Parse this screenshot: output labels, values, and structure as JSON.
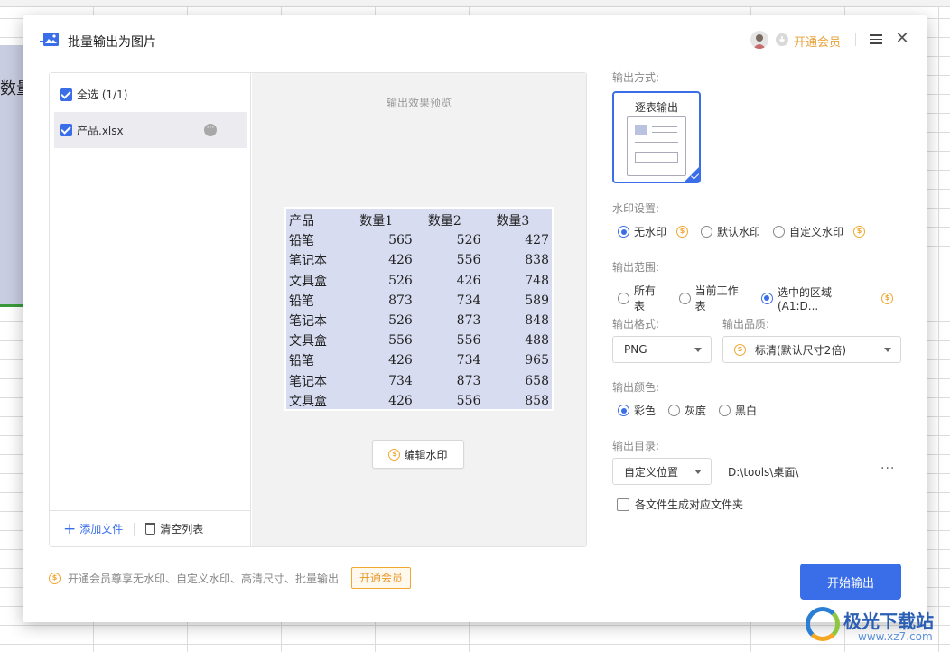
{
  "background": {
    "cell_text": "数量"
  },
  "dialog": {
    "title": "批量输出为图片",
    "vip_link": "开通会员"
  },
  "file_list": {
    "select_all": "全选 (1/1)",
    "files": [
      {
        "name": "产品.xlsx",
        "checked": true
      }
    ],
    "add_file": "添加文件",
    "clear_list": "清空列表"
  },
  "preview": {
    "label": "输出效果预览",
    "header": [
      "产品",
      "数量1",
      "数量2",
      "数量3"
    ],
    "rows": [
      [
        "铅笔",
        "565",
        "526",
        "427"
      ],
      [
        "笔记本",
        "426",
        "556",
        "838"
      ],
      [
        "文具盒",
        "526",
        "426",
        "748"
      ],
      [
        "铅笔",
        "873",
        "734",
        "589"
      ],
      [
        "笔记本",
        "526",
        "873",
        "848"
      ],
      [
        "文具盒",
        "556",
        "556",
        "488"
      ],
      [
        "铅笔",
        "426",
        "734",
        "965"
      ],
      [
        "笔记本",
        "734",
        "873",
        "658"
      ],
      [
        "文具盒",
        "426",
        "556",
        "858"
      ]
    ],
    "edit_watermark": "编辑水印",
    "table_color": "#d7dcf1"
  },
  "settings": {
    "output_mode_label": "输出方式:",
    "output_mode_card": "逐表输出",
    "watermark_label": "水印设置:",
    "watermark_options": [
      "无水印",
      "默认水印",
      "自定义水印"
    ],
    "watermark_selected": 0,
    "range_label": "输出范围:",
    "range_options": [
      "所有表",
      "当前工作表",
      "选中的区域(A1:D..."
    ],
    "range_selected": 2,
    "format_label": "输出格式:",
    "format_value": "PNG",
    "quality_label": "输出品质:",
    "quality_value": "标清(默认尺寸2倍)",
    "color_label": "输出颜色:",
    "color_options": [
      "彩色",
      "灰度",
      "黑白"
    ],
    "color_selected": 0,
    "dir_label": "输出目录:",
    "dir_mode": "自定义位置",
    "dir_path": "D:\\tools\\桌面\\",
    "dir_more": "···",
    "folder_option": "各文件生成对应文件夹",
    "folder_checked": false
  },
  "footer": {
    "promo": "开通会员尊享无水印、自定义水印、高清尺寸、批量输出",
    "vip_tag": "开通会员",
    "start_button": "开始输出"
  },
  "watermark_logo": {
    "name": "极光下载站",
    "url": "www.xz7.com"
  },
  "colors": {
    "accent": "#3a6ee8",
    "vip": "#e8a33a"
  },
  "icons": {
    "coin": "coin-icon",
    "app": "image-export-icon"
  }
}
